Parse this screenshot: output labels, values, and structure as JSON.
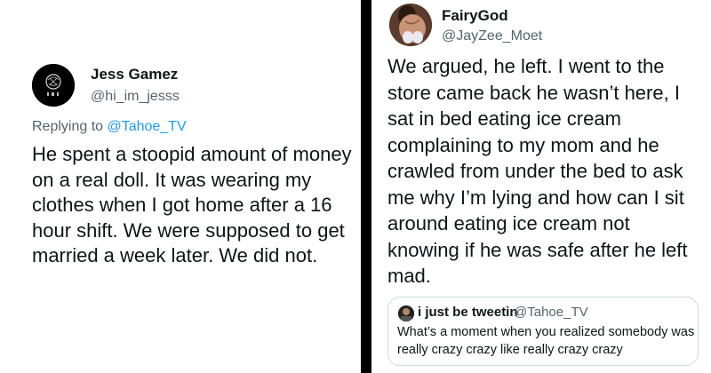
{
  "left_tweet": {
    "display_name": "Jess Gamez",
    "handle": "@hi_im_jesss",
    "replying_prefix": "Replying to ",
    "replying_to": "@Tahoe_TV",
    "body": "He spent a stoopid amount of money on a real doll. It was wearing my clothes when I got home after a 16 hour shift. We were supposed to get married a week later. We did not."
  },
  "right_tweet": {
    "display_name": "FairyGod",
    "handle": "@JayZee_Moet",
    "body": "We argued, he left. I went to the store came back he wasn’t here, I sat in bed eating ice cream complaining to my mom and he crawled from under the bed to ask me why I’m lying and how can I sit around eating ice cream not knowing if he was safe after he left mad.",
    "quote": {
      "display_name": "i just be tweetin",
      "handle": "@Tahoe_TV",
      "body": "What’s a moment when you realized somebody was really crazy crazy like really crazy crazy"
    }
  }
}
